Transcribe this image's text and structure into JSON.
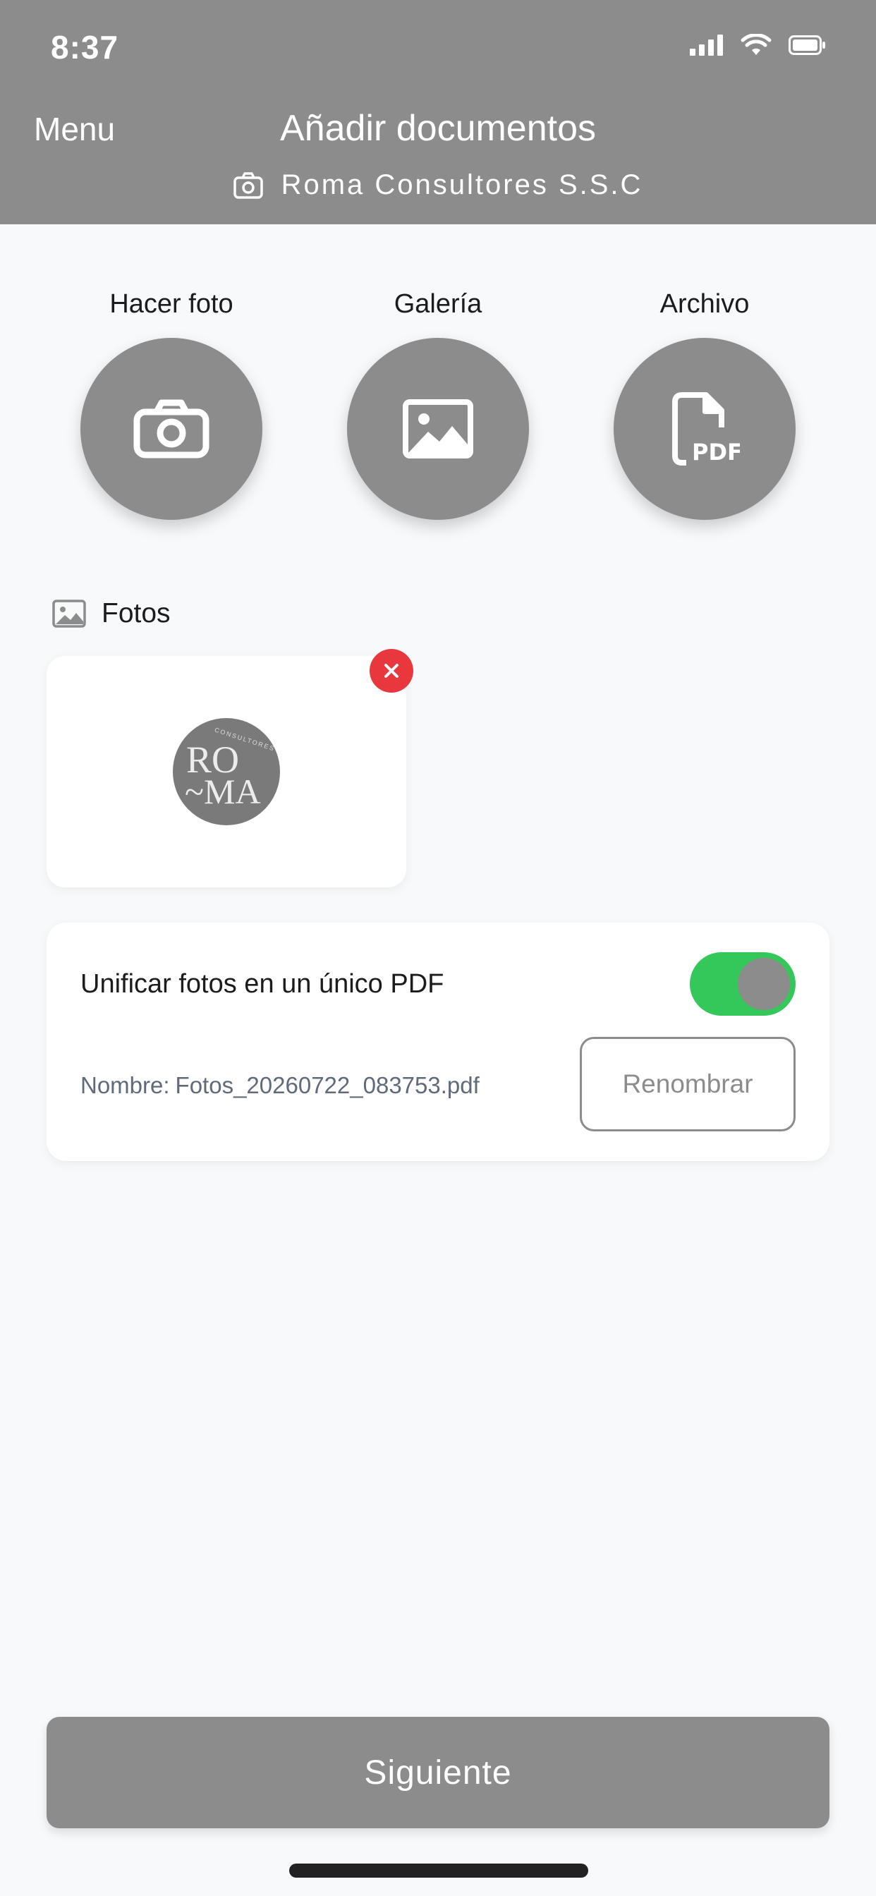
{
  "status_bar": {
    "time": "8:37"
  },
  "header": {
    "menu_label": "Menu",
    "title": "Añadir documentos",
    "company": "Roma Consultores S.S.C"
  },
  "actions": [
    {
      "label": "Hacer foto",
      "icon": "camera-icon"
    },
    {
      "label": "Galería",
      "icon": "image-icon"
    },
    {
      "label": "Archivo",
      "icon": "pdf-file-icon"
    }
  ],
  "photos_section": {
    "heading": "Fotos",
    "logo_text": "RO-MA CONSULTORES"
  },
  "unify": {
    "label": "Unificar fotos en un único PDF",
    "enabled": true,
    "name_prefix": "Nombre:",
    "file_name": "Fotos_20260722_083753.pdf",
    "rename_label": "Renombrar"
  },
  "footer": {
    "next_label": "Siguiente"
  },
  "colors": {
    "header_bg": "#8c8c8c",
    "accent_gray": "#8c8c8c",
    "toggle_on": "#34c759",
    "remove_red": "#e8383e",
    "page_bg": "#f8f9fb"
  }
}
